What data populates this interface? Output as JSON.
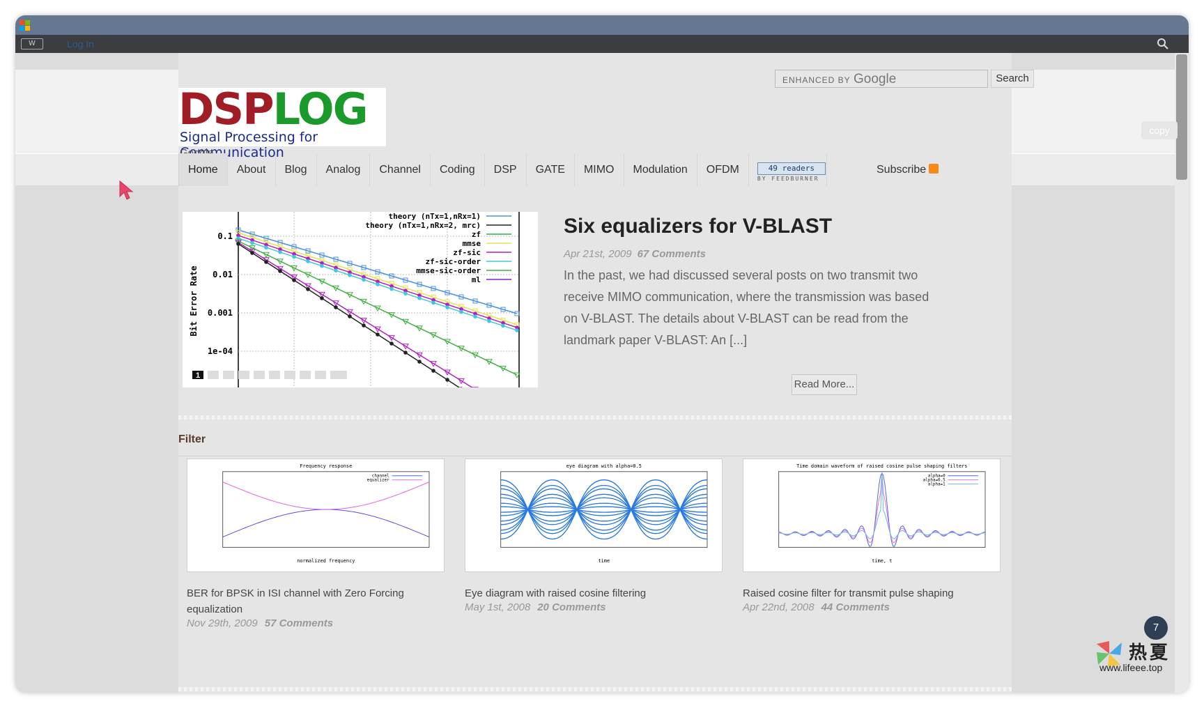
{
  "admin_bar": {
    "login": "Log In"
  },
  "search": {
    "enhanced_by": "ENHANCED BY",
    "google": "Google",
    "button": "Search"
  },
  "logo": {
    "dsp": "DSP",
    "log": "LOG",
    "tagline": "Signal Processing for Communication",
    "google": "Google"
  },
  "copy_button": "copy",
  "nav": {
    "items": [
      "Home",
      "About",
      "Blog",
      "Analog",
      "Channel",
      "Coding",
      "DSP",
      "GATE",
      "MIMO",
      "Modulation",
      "OFDM"
    ],
    "feed": {
      "count": "49",
      "readers": "readers",
      "by": "BY FEEDBURNER"
    },
    "subscribe": "Subscribe"
  },
  "featured": {
    "title": "Six equalizers for V-BLAST",
    "date": "Apr 21st, 2009",
    "comments": "67 Comments",
    "excerpt": "In the past, we had discussed several posts on two transmit two receive MIMO communication, where the transmission was based on V-BLAST. The details about V-BLAST can be read from the landmark paper V-BLAST: An [...]",
    "read_more": "Read More...",
    "slider_active": "1",
    "image": {
      "ylabel": "Bit Error Rate",
      "yticks": [
        "0.1",
        "0.01",
        "0.001",
        "1e-04"
      ],
      "legend": [
        "theory (nTx=1,nRx=1)",
        "theory (nTx=1,nRx=2, mrc)",
        "zf",
        "mmse",
        "zf-sic",
        "zf-sic-order",
        "mmse-sic-order",
        "ml"
      ]
    }
  },
  "section": {
    "label": "Filter"
  },
  "cards": [
    {
      "title": "BER for BPSK in ISI channel with Zero Forcing equalization",
      "date": "Nov 29th, 2009",
      "comments": "57 Comments",
      "img_title": "Frequency response",
      "img_legend": [
        "channel",
        "equalizer"
      ],
      "img_xlabel": "normalized frequency"
    },
    {
      "title": "Eye diagram with raised cosine filtering",
      "date": "May 1st, 2008",
      "comments": "20 Comments",
      "img_title": "eye diagram with alpha=0.5",
      "img_xlabel": "time"
    },
    {
      "title": "Raised cosine filter for transmit pulse shaping",
      "date": "Apr 22nd, 2008",
      "comments": "44 Comments",
      "img_title": "Time domain waveform of raised cosine pulse shaping filters",
      "img_legend": [
        "alpha=0",
        "alpha=0.5",
        "alpha=1"
      ],
      "img_xlabel": "time, t"
    }
  ],
  "overlay": {
    "badge": "7",
    "watermark_cn": "热夏",
    "watermark_url": "www.lifeee.top"
  }
}
